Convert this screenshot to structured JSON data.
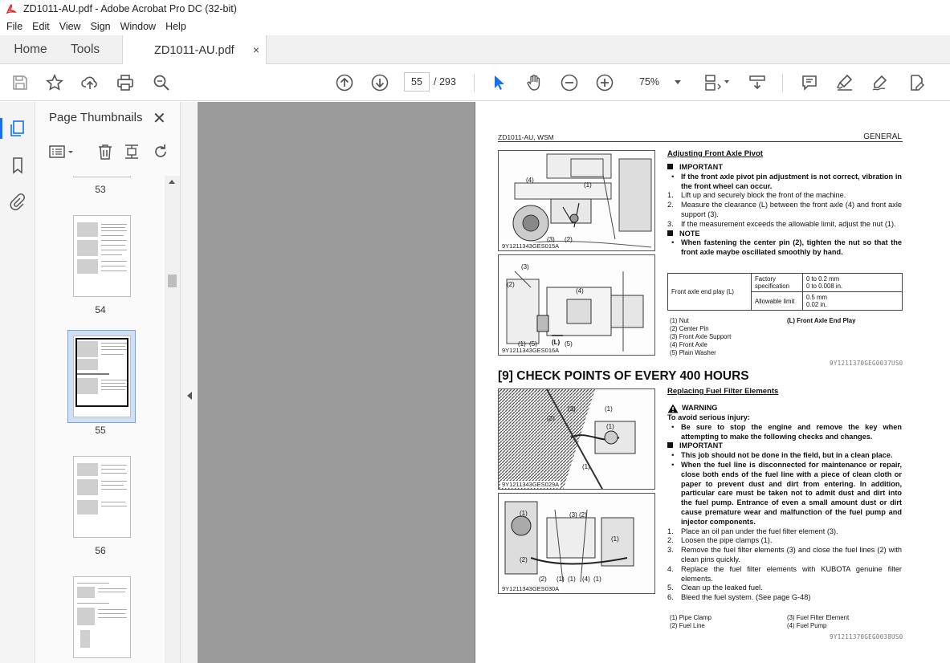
{
  "window": {
    "title": "ZD1011-AU.pdf - Adobe Acrobat Pro DC (32-bit)",
    "menu": [
      "File",
      "Edit",
      "View",
      "Sign",
      "Window",
      "Help"
    ]
  },
  "tabs": {
    "home": "Home",
    "tools": "Tools",
    "document": "ZD1011-AU.pdf",
    "close": "×"
  },
  "toolbar": {
    "current_page": "55",
    "total_pages": "/ 293",
    "zoom": "75%",
    "icons": [
      "save-icon",
      "star-icon",
      "upload-icon",
      "print-icon",
      "zoom-search-icon",
      "page-up-icon",
      "page-down-icon",
      "select-cursor-icon",
      "hand-icon",
      "zoom-out-icon",
      "zoom-in-icon",
      "fit-page-icon",
      "scroll-mode-icon",
      "comment-icon",
      "highlight-icon",
      "sign-icon",
      "edit-pdf-icon"
    ]
  },
  "panel": {
    "title": "Page Thumbnails",
    "close": "✕",
    "thumbnails": [
      {
        "label": "53"
      },
      {
        "label": "54"
      },
      {
        "label": "55"
      },
      {
        "label": "56"
      },
      {
        "label": ""
      }
    ]
  },
  "page": {
    "header_left": "ZD1011-AU, WSM",
    "header_right": "GENERAL",
    "fig1_caption": "9Y1211343GES015A",
    "fig2_caption": "9Y1211343GES016A",
    "fig3_caption": "9Y1211343GES029A",
    "fig4_caption": "9Y1211343GES030A",
    "sec1": {
      "title": "Adjusting Front Axle Pivot",
      "important": "IMPORTANT",
      "important_text": "If the front axle pivot pin adjustment is not correct, vibration in the front wheel can occur.",
      "steps": [
        "Lift up and securely block the front of the machine.",
        "Measure the clearance (L) between the front axle (4) and front axle support (3).",
        "If the measurement exceeds the allowable limit, adjust the nut (1)."
      ],
      "note": "NOTE",
      "note_text": "When fastening the center pin (2), tighten the nut so that the front axle maybe oscillated smoothly by hand.",
      "table": {
        "label": "Front axle end play (L)",
        "factory_label": "Factory specification",
        "factory_value": "0 to 0.2 mm",
        "factory_value2": "0 to 0.008 in.",
        "limit_label": "Allowable limit",
        "limit_value": "0.5 mm",
        "limit_value2": "0.02 in."
      },
      "legend": [
        "(1)   Nut",
        "(2)   Center Pin",
        "(3)   Front Axle Support",
        "(4)   Front Axle",
        "(5)   Plain Washer"
      ],
      "legend_right": "(L)   Front Axle End Play",
      "code": "9Y1211370GEG0037US0"
    },
    "heading": "[9]  CHECK POINTS OF EVERY 400 HOURS",
    "sec2": {
      "title": "Replacing Fuel Filter Elements",
      "warning": "WARNING",
      "warning_lead": "To avoid serious injury:",
      "warning_text": "Be sure to stop the engine and remove the key when attempting to make the following checks and changes.",
      "important": "IMPORTANT",
      "imp1": "This job should not be done in the field, but in a clean place.",
      "imp2": "When the fuel line is disconnected for maintenance or repair, close both ends of the fuel line with a piece of clean cloth or paper to prevent dust and dirt from entering. In addition, particular care must be taken not to admit dust and dirt into the fuel pump. Entrance of even a small amount dust or dirt cause premature wear and malfunction of the fuel pump and injector components.",
      "steps": [
        "Place an oil pan under the fuel filter element (3).",
        "Loosen the pipe clamps (1).",
        "Remove the fuel filter elements (3) and close the fuel lines (2) with clean pins quickly.",
        "Replace the fuel filter elements with KUBOTA genuine filter elements.",
        "Clean up the leaked fuel.",
        "Bleed the fuel system. (See page G-48)"
      ],
      "legend_left": [
        "(1)   Pipe Clamp",
        "(2)   Fuel Line"
      ],
      "legend_right": [
        "(3)   Fuel Filter Element",
        "(4)   Fuel Pump"
      ],
      "code": "9Y1211370GEG0038US0"
    }
  }
}
